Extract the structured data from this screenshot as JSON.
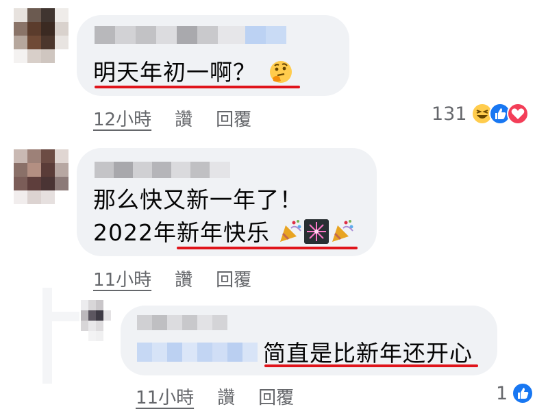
{
  "comments": [
    {
      "text_lines": [
        "明天年初一啊？"
      ],
      "time": "12小時",
      "like": "讚",
      "reply": "回覆",
      "reaction_count": "131",
      "reactions": [
        "haha-icon",
        "like-icon",
        "love-icon"
      ]
    },
    {
      "text_lines": [
        "那么快又新一年了！",
        "2022年新年快乐"
      ],
      "time": "11小時",
      "like": "讚",
      "reply": "回覆"
    },
    {
      "text_lines": [
        "简直是比新年还开心"
      ],
      "time": "11小時",
      "like": "讚",
      "reply": "回覆",
      "reaction_count": "1",
      "reactions": [
        "like-icon"
      ]
    }
  ],
  "colors": {
    "bubble": "#f0f2f5",
    "underline": "#e0141b",
    "meta_text": "#65676b",
    "like_blue": "#1877f2",
    "love_red": "#f33e58"
  },
  "emoji": {
    "c1_trailing": "thinking-face-emoji",
    "c2_trailing": [
      "party-popper-emoji",
      "fireworks-emoji",
      "party-popper-emoji"
    ]
  }
}
